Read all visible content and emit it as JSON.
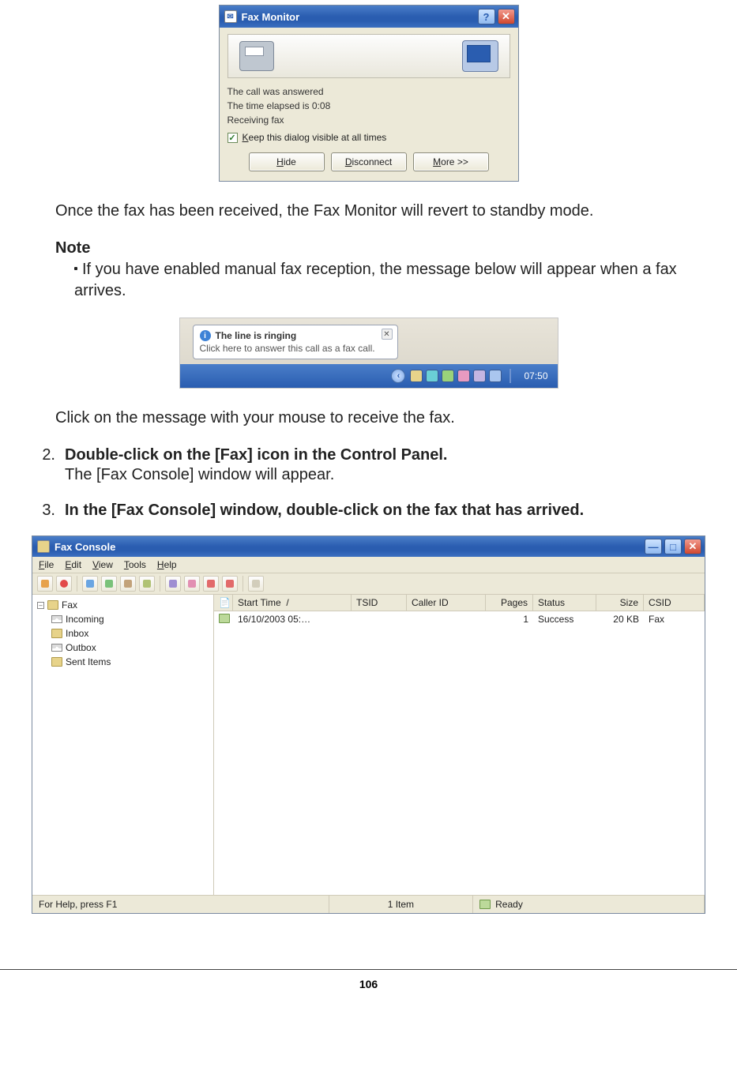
{
  "fax_monitor": {
    "title": "Fax Monitor",
    "status_lines": [
      "The call was answered",
      "The time elapsed is 0:08",
      "Receiving fax"
    ],
    "keep_visible_checked": true,
    "keep_visible_label": "Keep this dialog visible at all times",
    "buttons": {
      "hide": "Hide",
      "disconnect": "Disconnect",
      "more": "More >>"
    }
  },
  "text": {
    "para_after_monitor": "Once the fax has been received, the Fax Monitor will revert to standby mode.",
    "note_heading": "Note",
    "note_body": "If you have enabled manual fax reception, the message below will appear when a fax arrives.",
    "click_message": "Click on the message with your mouse to receive the fax."
  },
  "balloon": {
    "title": "The line is ringing",
    "body": "Click here to answer this call as a fax call.",
    "clock": "07:50"
  },
  "steps": {
    "s2": {
      "num": "2.",
      "heading": "Double-click on the [Fax] icon in the Control Panel.",
      "sub": "The [Fax Console] window will appear."
    },
    "s3": {
      "num": "3.",
      "heading": "In the [Fax Console] window, double-click on the fax that has arrived."
    }
  },
  "fax_console": {
    "title": "Fax Console",
    "menu": {
      "file": "File",
      "edit": "Edit",
      "view": "View",
      "tools": "Tools",
      "help": "Help"
    },
    "tree": {
      "root": "Fax",
      "items": [
        "Incoming",
        "Inbox",
        "Outbox",
        "Sent Items"
      ]
    },
    "columns": {
      "icon": "",
      "start": "Start Time",
      "sort": "/",
      "tsid": "TSID",
      "caller": "Caller ID",
      "pages": "Pages",
      "status": "Status",
      "size": "Size",
      "csid": "CSID"
    },
    "rows": [
      {
        "start": "16/10/2003 05:…",
        "tsid": "",
        "caller": "",
        "pages": "1",
        "status": "Success",
        "size": "20 KB",
        "csid": "Fax"
      }
    ],
    "statusbar": {
      "help": "For Help, press F1",
      "count": "1 Item",
      "ready": "Ready"
    }
  },
  "footer": {
    "page": "106"
  }
}
